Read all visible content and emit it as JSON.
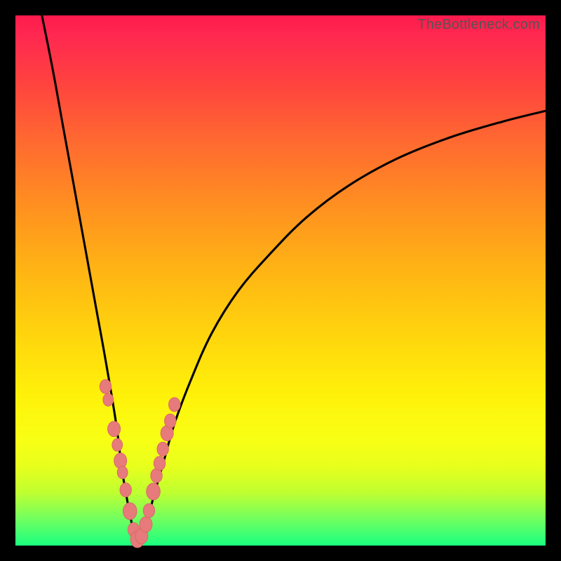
{
  "watermark": "TheBottleneck.com",
  "colors": {
    "page_bg": "#000000",
    "gradient_top": "#ff1a4d",
    "gradient_bottom": "#1aff80",
    "curve_stroke": "#000000",
    "marker_fill": "#e77a7a",
    "marker_outline": "#d86a6a"
  },
  "chart_data": {
    "type": "line",
    "title": "",
    "xlabel": "",
    "ylabel": "",
    "xlim": [
      0,
      100
    ],
    "ylim": [
      0,
      100
    ],
    "grid": false,
    "legend": false,
    "notes": "V-shaped bottleneck curve. Y is a mismatch-style metric that drops to ~0 near x≈23 and rises on both sides. No numeric axis labels are visible; values below are read off the image in percent-of-frame coordinates (0–100 each axis, left/bottom origin).",
    "series": [
      {
        "name": "bottleneck-curve",
        "x": [
          5,
          7,
          9,
          11,
          13,
          15,
          17,
          19,
          20,
          21,
          22,
          23,
          24,
          25,
          26,
          28,
          30,
          33,
          37,
          42,
          48,
          55,
          63,
          72,
          82,
          92,
          100
        ],
        "values": [
          100,
          90,
          79,
          68,
          57,
          46,
          35,
          23,
          15,
          9,
          4,
          1,
          2,
          5,
          9,
          16,
          23,
          31,
          40,
          48,
          55,
          62,
          68,
          73,
          77,
          80,
          82
        ]
      }
    ],
    "markers": {
      "name": "highlighted-points",
      "comment": "Pink bead clusters along the lower V region",
      "x": [
        17.0,
        17.5,
        18.6,
        19.2,
        19.8,
        20.2,
        20.8,
        21.6,
        22.3,
        23.0,
        23.8,
        24.6,
        25.2,
        26.0,
        26.6,
        27.2,
        27.8,
        28.6,
        29.2,
        30.0
      ],
      "values": [
        30.0,
        27.5,
        22.0,
        19.0,
        16.0,
        13.8,
        10.5,
        6.5,
        3.0,
        1.2,
        1.8,
        4.0,
        6.6,
        10.2,
        13.2,
        15.5,
        18.2,
        21.2,
        23.5,
        26.6
      ],
      "r": [
        10,
        9,
        11,
        9,
        11,
        9,
        10,
        12,
        10,
        12,
        11,
        11,
        10,
        12,
        10,
        10,
        10,
        11,
        10,
        10
      ]
    }
  }
}
